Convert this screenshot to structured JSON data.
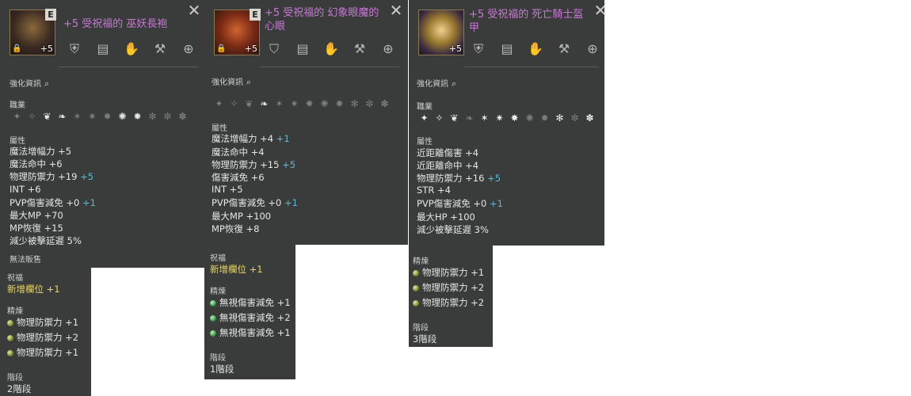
{
  "tooltips": [
    {
      "title": "+5 受祝福的 巫妖長袍",
      "grade": "E",
      "enchant": "+5",
      "section_enhance": "強化資訊",
      "section_class": "職業",
      "section_attr": "屬性",
      "attrs": [
        {
          "name": "魔法增幅力 +5",
          "bonus": ""
        },
        {
          "name": "魔法命中 +6",
          "bonus": ""
        },
        {
          "name": "物理防禦力 +19",
          "bonus": "+5"
        },
        {
          "name": "INT +6",
          "bonus": ""
        },
        {
          "name": "PVP傷害減免 +0",
          "bonus": "+1"
        },
        {
          "name": "最大MP +70",
          "bonus": ""
        },
        {
          "name": "MP恢復 +15",
          "bonus": ""
        },
        {
          "name": "減少被擊延遲 5%",
          "bonus": ""
        }
      ],
      "unsellable": "無法販售",
      "blessing_label": "祝福",
      "blessing_value": "新增欄位 +1",
      "refine_label": "精煉",
      "refine": [
        "物理防禦力 +1",
        "物理防禦力 +2",
        "物理防禦力 +1"
      ],
      "stage_label": "階段",
      "stage_value": "2階段"
    },
    {
      "title": "+5 受祝福的 幻象眼魔的心眼",
      "grade": "E",
      "enchant": "+5",
      "section_enhance": "強化資訊",
      "section_attr": "屬性",
      "attrs": [
        {
          "name": "魔法增幅力 +4",
          "bonus": "+1"
        },
        {
          "name": "魔法命中 +4",
          "bonus": ""
        },
        {
          "name": "物理防禦力 +15",
          "bonus": "+5"
        },
        {
          "name": "傷害減免 +6",
          "bonus": ""
        },
        {
          "name": "INT +5",
          "bonus": ""
        },
        {
          "name": "PVP傷害減免 +0",
          "bonus": "+1"
        },
        {
          "name": "最大MP +100",
          "bonus": ""
        },
        {
          "name": "MP恢復 +8",
          "bonus": ""
        }
      ],
      "blessing_label": "祝福",
      "blessing_value": "新增欄位 +1",
      "refine_label": "精煉",
      "refine": [
        "無視傷害減免 +1",
        "無視傷害減免 +2",
        "無視傷害減免 +1"
      ],
      "stage_label": "階段",
      "stage_value": "1階段"
    },
    {
      "title": "+5 受祝福的 死亡騎士盔甲",
      "enchant": "+5",
      "section_enhance": "強化資訊",
      "section_class": "職業",
      "section_attr": "屬性",
      "attrs": [
        {
          "name": "近距離傷害 +4",
          "bonus": ""
        },
        {
          "name": "近距離命中 +4",
          "bonus": ""
        },
        {
          "name": "物理防禦力 +16",
          "bonus": "+5"
        },
        {
          "name": "STR +4",
          "bonus": ""
        },
        {
          "name": "PVP傷害減免 +0",
          "bonus": "+1"
        },
        {
          "name": "最大HP +100",
          "bonus": ""
        },
        {
          "name": "減少被擊延遲 3%",
          "bonus": ""
        }
      ],
      "refine_label": "精煉",
      "refine": [
        "物理防禦力 +1",
        "物理防禦力 +2",
        "物理防禦力 +2"
      ],
      "stage_label": "階段",
      "stage_value": "3階段"
    }
  ]
}
